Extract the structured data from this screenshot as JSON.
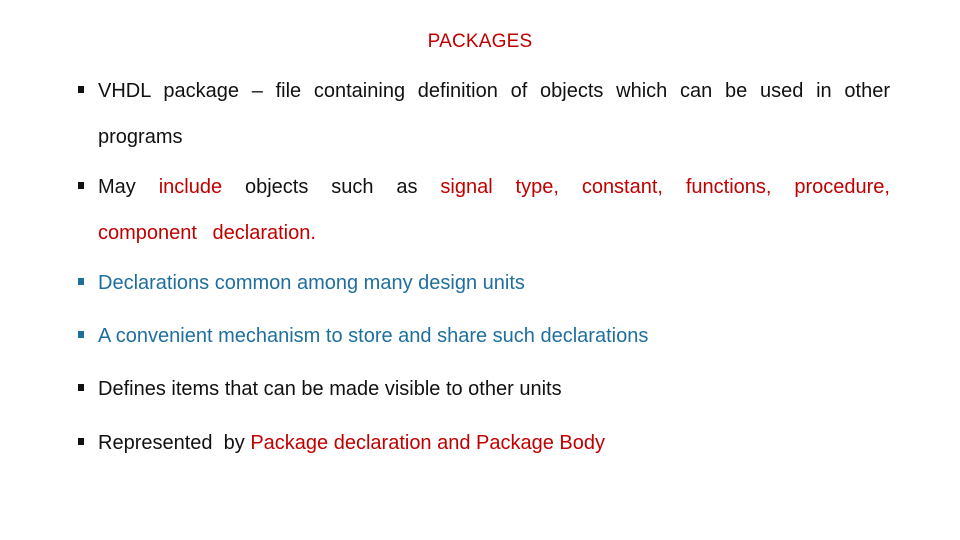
{
  "slide": {
    "title": "PACKAGES",
    "colors": {
      "text": "#111111",
      "highlight_red": "#c00000",
      "accent_blue": "#1f6f9e"
    },
    "bullets": [
      {
        "icon": "square-bullet-icon",
        "segments": [
          {
            "text": "VHDL package – file containing definition of objects which can be used in other programs",
            "color": "black"
          }
        ]
      },
      {
        "icon": "square-bullet-icon",
        "segments": [
          {
            "text": "May ",
            "color": "black"
          },
          {
            "text": "include",
            "color": "red"
          },
          {
            "text": " objects such as ",
            "color": "black"
          },
          {
            "text": "signal type, constant, functions, procedure, component declaration.",
            "color": "red"
          }
        ]
      },
      {
        "icon": "square-bullet-icon",
        "segments": [
          {
            "text": "Declarations common among many design units",
            "color": "blue"
          }
        ]
      },
      {
        "icon": "square-bullet-icon",
        "segments": [
          {
            "text": "A convenient mechanism to store and share such declarations",
            "color": "blue"
          }
        ]
      },
      {
        "icon": "square-bullet-icon",
        "segments": [
          {
            "text": "Defines items that can be made visible to other units",
            "color": "black"
          }
        ]
      },
      {
        "icon": "square-bullet-icon",
        "segments": [
          {
            "text": "Represented  by ",
            "color": "black"
          },
          {
            "text": "Package declaration and Package Body",
            "color": "red"
          }
        ]
      }
    ]
  }
}
